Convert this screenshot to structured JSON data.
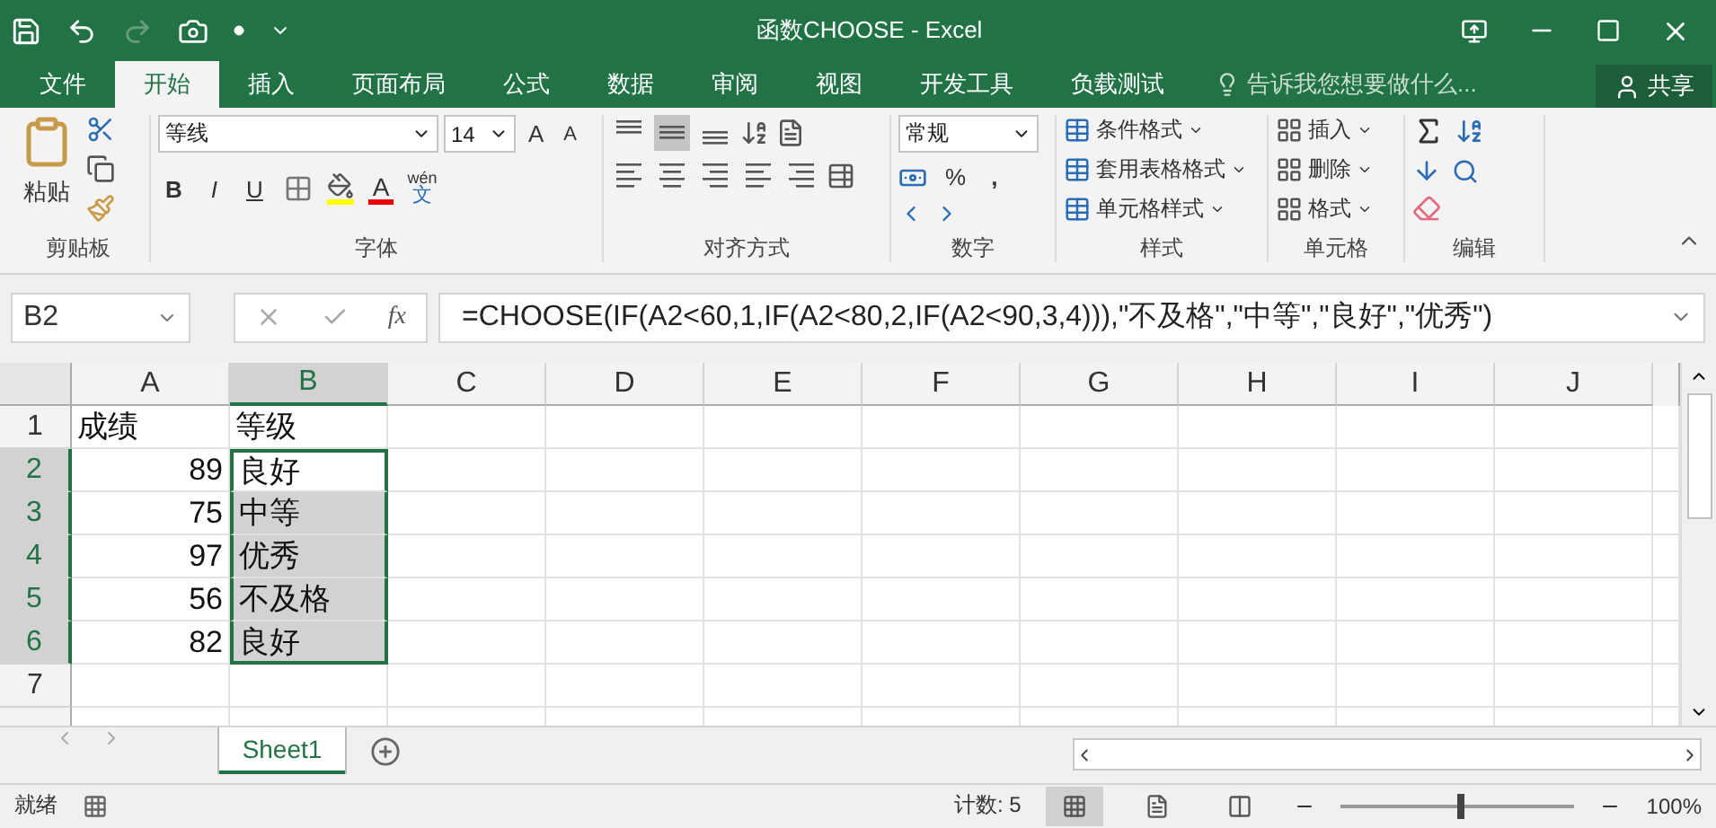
{
  "window": {
    "title": "函数CHOOSE - Excel"
  },
  "tabs": [
    {
      "label": "文件",
      "selected": false
    },
    {
      "label": "开始",
      "selected": true
    },
    {
      "label": "插入",
      "selected": false
    },
    {
      "label": "页面布局",
      "selected": false
    },
    {
      "label": "公式",
      "selected": false
    },
    {
      "label": "数据",
      "selected": false
    },
    {
      "label": "审阅",
      "selected": false
    },
    {
      "label": "视图",
      "selected": false
    },
    {
      "label": "开发工具",
      "selected": false
    },
    {
      "label": "负载测试",
      "selected": false
    }
  ],
  "tell_me": {
    "placeholder": "告诉我您想要做什么..."
  },
  "share": "共享",
  "ribbon": {
    "clipboard": {
      "paste": "粘贴",
      "label": "剪贴板"
    },
    "font": {
      "name": "等线",
      "size": "14",
      "grow": "A",
      "shrink": "A",
      "bold": "B",
      "italic": "I",
      "underline": "U",
      "font_color_label": "A",
      "phonetic_top": "wén",
      "phonetic_bottom": "文",
      "label": "字体"
    },
    "alignment": {
      "label": "对齐方式"
    },
    "number": {
      "format": "常规",
      "percent": "%",
      "comma": ",",
      "label": "数字"
    },
    "styles": {
      "items": [
        "条件格式",
        "套用表格格式",
        "单元格样式"
      ],
      "label": "样式"
    },
    "cells": {
      "items": [
        "插入",
        "删除",
        "格式"
      ],
      "label": "单元格"
    },
    "editing": {
      "label": "编辑"
    }
  },
  "name_box": "B2",
  "fx": "fx",
  "formula": "=CHOOSE(IF(A2<60,1,IF(A2<80,2,IF(A2<90,3,4))),\"不及格\",\"中等\",\"良好\",\"优秀\")",
  "columns": [
    {
      "label": "A",
      "selected": false
    },
    {
      "label": "B",
      "selected": true
    },
    {
      "label": "C",
      "selected": false
    },
    {
      "label": "D",
      "selected": false
    },
    {
      "label": "E",
      "selected": false
    },
    {
      "label": "F",
      "selected": false
    },
    {
      "label": "G",
      "selected": false
    },
    {
      "label": "H",
      "selected": false
    },
    {
      "label": "I",
      "selected": false
    },
    {
      "label": "J",
      "selected": false
    }
  ],
  "rows": [
    {
      "number": "1",
      "selected": false,
      "cells": [
        {
          "value": "成绩",
          "kind": "text",
          "selected": false,
          "active": false
        },
        {
          "value": "等级",
          "kind": "text",
          "selected": false,
          "active": false
        }
      ]
    },
    {
      "number": "2",
      "selected": true,
      "cells": [
        {
          "value": "89",
          "kind": "number",
          "selected": false,
          "active": false
        },
        {
          "value": "良好",
          "kind": "text",
          "selected": true,
          "active": true
        }
      ]
    },
    {
      "number": "3",
      "selected": true,
      "cells": [
        {
          "value": "75",
          "kind": "number",
          "selected": false,
          "active": false
        },
        {
          "value": "中等",
          "kind": "text",
          "selected": true,
          "active": false
        }
      ]
    },
    {
      "number": "4",
      "selected": true,
      "cells": [
        {
          "value": "97",
          "kind": "number",
          "selected": false,
          "active": false
        },
        {
          "value": "优秀",
          "kind": "text",
          "selected": true,
          "active": false
        }
      ]
    },
    {
      "number": "5",
      "selected": true,
      "cells": [
        {
          "value": "56",
          "kind": "number",
          "selected": false,
          "active": false
        },
        {
          "value": "不及格",
          "kind": "text",
          "selected": true,
          "active": false
        }
      ]
    },
    {
      "number": "6",
      "selected": true,
      "cells": [
        {
          "value": "82",
          "kind": "number",
          "selected": false,
          "active": false
        },
        {
          "value": "良好",
          "kind": "text",
          "selected": true,
          "active": false
        }
      ]
    },
    {
      "number": "7",
      "selected": false,
      "cells": []
    }
  ],
  "sheets": [
    {
      "label": "Sheet1",
      "selected": true
    }
  ],
  "status_bar": {
    "ready": "就绪",
    "count": "计数: 5",
    "zoom": "100%",
    "zoom_level": {
      "level": 0.5
    }
  }
}
